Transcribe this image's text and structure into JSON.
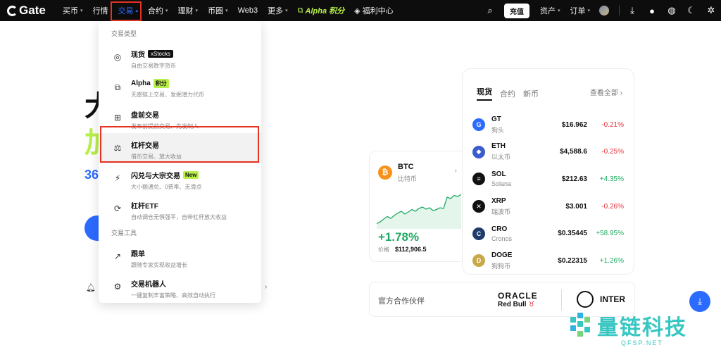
{
  "header": {
    "logo": "Gate",
    "nav": [
      {
        "label": "买币",
        "caret": true
      },
      {
        "label": "行情",
        "caret": false
      },
      {
        "label": "交易",
        "caret": true,
        "active": true
      },
      {
        "label": "合约",
        "caret": true
      },
      {
        "label": "理财",
        "caret": true
      },
      {
        "label": "币圈",
        "caret": true
      },
      {
        "label": "Web3",
        "caret": false
      },
      {
        "label": "更多",
        "caret": true
      }
    ],
    "alpha_label": "Alpha 积分",
    "welfare_label": "福利中心",
    "deposit_label": "充值",
    "assets_label": "资产",
    "orders_label": "订单"
  },
  "hero": {
    "line1": "大",
    "line2": "加",
    "line3": "36"
  },
  "dropdown": {
    "section_types": "交易类型",
    "section_tools": "交易工具",
    "items": [
      {
        "title": "现货",
        "tag": "xStocks",
        "desc": "自由交易数字货币"
      },
      {
        "title": "Alpha",
        "tag": "积分",
        "desc": "无惑链上交易、发掘潜力代币"
      },
      {
        "title": "盘前交易",
        "desc": "发布前提前交易、先发制人"
      },
      {
        "title": "杠杆交易",
        "desc": "借币交易、放大收益"
      },
      {
        "title": "闪兑与大宗交易",
        "tag": "New",
        "desc": "大小额通兑、0费率、无滑点"
      },
      {
        "title": "杠杆ETF",
        "desc": "自动调仓无惧强平，自带杠杆放大收益"
      },
      {
        "title": "跟单",
        "desc": "跟随专家实现收益增长"
      },
      {
        "title": "交易机器人",
        "desc": "一键复制丰富策略、高效自动执行"
      }
    ]
  },
  "market": {
    "tabs": [
      "现货",
      "合约",
      "新币"
    ],
    "view_all": "查看全部",
    "rows": [
      {
        "sym": "GT",
        "cn": "狗头",
        "price": "$16.962",
        "chg": "-0.21%",
        "color": "#2c6bff",
        "icon": "G"
      },
      {
        "sym": "ETH",
        "cn": "以太币",
        "price": "$4,588.6",
        "chg": "-0.25%",
        "color": "#3b5ccc",
        "icon": "◆"
      },
      {
        "sym": "SOL",
        "cn": "Solana",
        "price": "$212.63",
        "chg": "+4.35%",
        "color": "#111111",
        "icon": "≡"
      },
      {
        "sym": "XRP",
        "cn": "瑞波币",
        "price": "$3.001",
        "chg": "-0.26%",
        "color": "#111111",
        "icon": "✕"
      },
      {
        "sym": "CRO",
        "cn": "Cronos",
        "price": "$0.35445",
        "chg": "+58.95%",
        "color": "#1d3b6b",
        "icon": "C"
      },
      {
        "sym": "DOGE",
        "cn": "狗狗币",
        "price": "$0.22315",
        "chg": "+1.26%",
        "color": "#c9a84a",
        "icon": "D"
      }
    ]
  },
  "btc": {
    "sym": "BTC",
    "cn": "比特币",
    "change": "+1.78%",
    "price_label": "价格",
    "price": "$112,906.5",
    "spark": [
      0.15,
      0.2,
      0.28,
      0.35,
      0.3,
      0.38,
      0.45,
      0.5,
      0.42,
      0.48,
      0.55,
      0.5,
      0.58,
      0.62,
      0.56,
      0.6,
      0.52,
      0.55,
      0.6,
      0.58,
      0.9,
      0.86,
      0.95,
      0.92,
      0.98
    ]
  },
  "partners": {
    "label": "官方合作伙伴",
    "oracle": "ORACLE",
    "redbull": "Red Bull",
    "inter": "INTER"
  },
  "watermark": {
    "text": "量链科技",
    "sub": "QFSP.NET"
  }
}
